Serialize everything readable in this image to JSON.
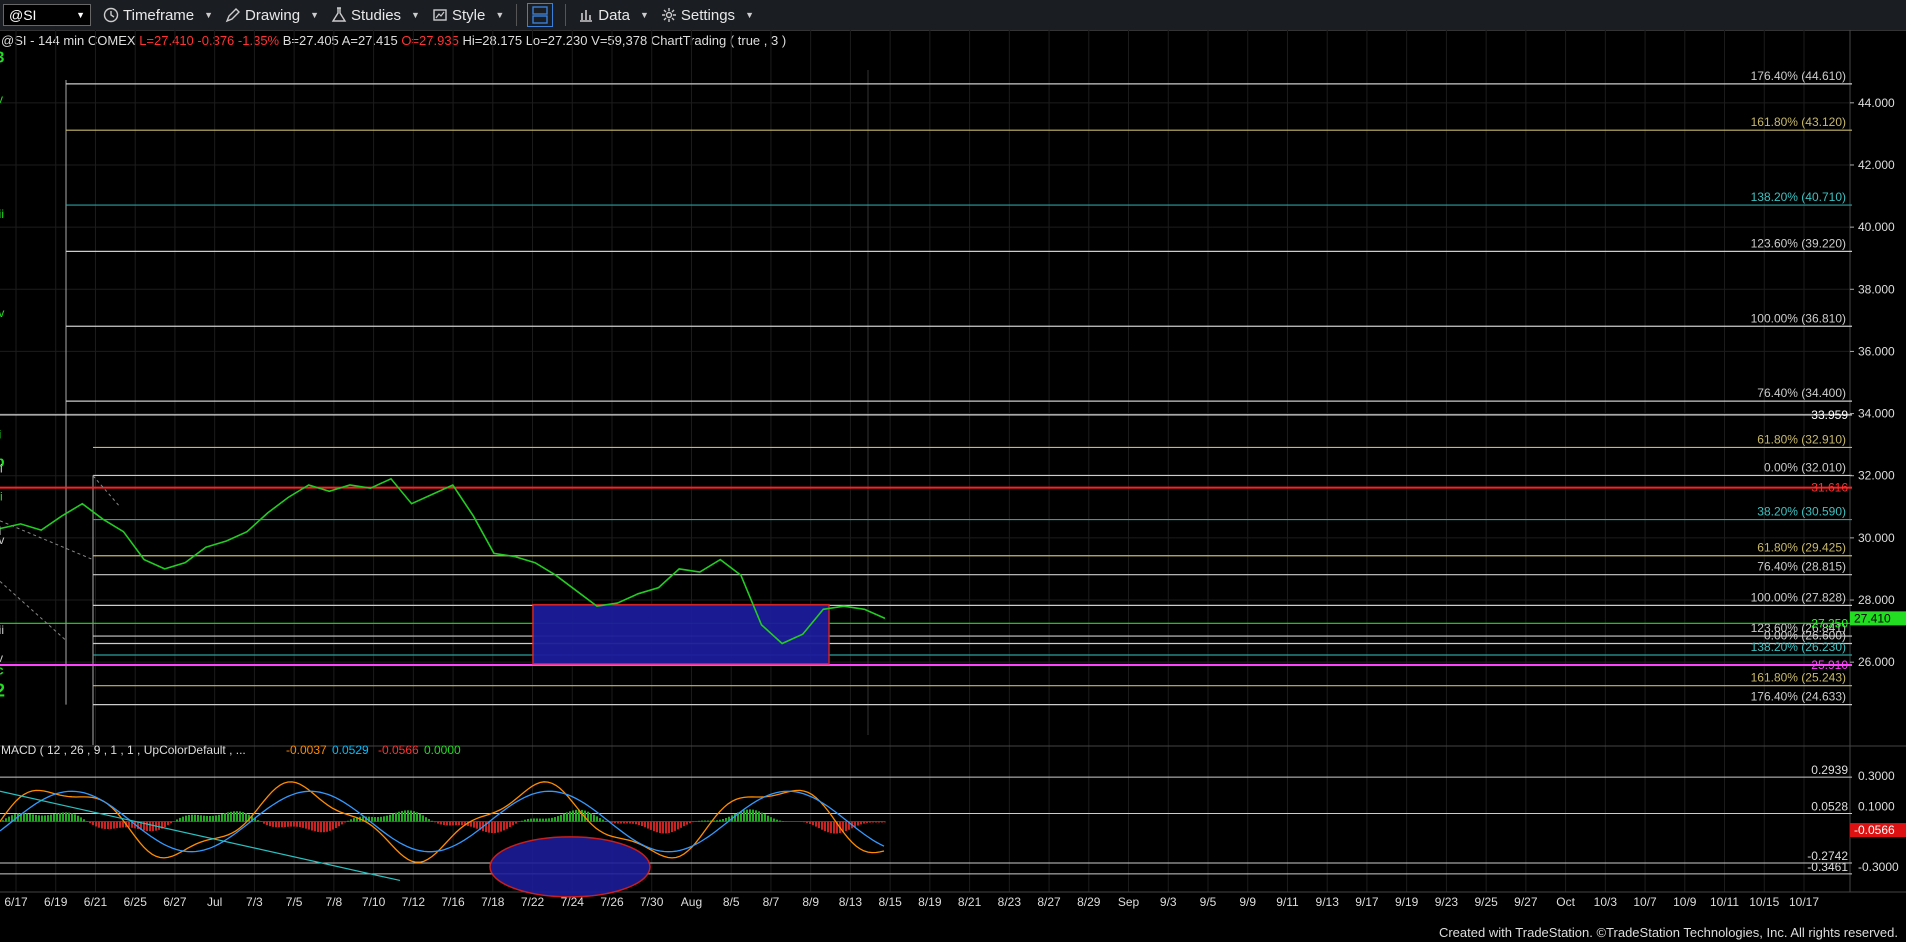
{
  "toolbar": {
    "symbol": "@SI",
    "timeframe": "Timeframe",
    "drawing": "Drawing",
    "studies": "Studies",
    "style": "Style",
    "data": "Data",
    "settings": "Settings"
  },
  "info": {
    "symbol_desc": "@SI - 144 min  COMEX",
    "last": "L=27.410",
    "change": "-0.376",
    "pct": "-1.35%",
    "bid": "B=27.405",
    "ask": "A=27.415",
    "open": "O=27.935",
    "high": "Hi=28.175",
    "low": "Lo=27.230",
    "vol": "V=59,378",
    "study": "ChartTrading ( true , 3 )"
  },
  "footer": "Created with TradeStation. ©TradeStation Technologies, Inc. All rights reserved.",
  "chart_data": {
    "type": "line",
    "price_axis": {
      "ylim": [
        24.3,
        45.7
      ],
      "ticks": [
        "44.000",
        "42.000",
        "40.000",
        "38.000",
        "36.000",
        "34.000",
        "32.000",
        "30.000",
        "28.000",
        "26.000"
      ],
      "tick_values": [
        44,
        42,
        40,
        38,
        36,
        34,
        32,
        30,
        28,
        26
      ]
    },
    "date_ticks": [
      "6/17",
      "6/19",
      "6/21",
      "6/25",
      "6/27",
      "Jul",
      "7/3",
      "7/5",
      "7/8",
      "7/10",
      "7/12",
      "7/16",
      "7/18",
      "7/22",
      "7/24",
      "7/26",
      "7/30",
      "Aug",
      "8/5",
      "8/7",
      "8/9",
      "8/13",
      "8/15",
      "8/19",
      "8/21",
      "8/23",
      "8/27",
      "8/29",
      "Sep",
      "9/3",
      "9/5",
      "9/9",
      "9/11",
      "9/13",
      "9/17",
      "9/19",
      "9/23",
      "9/25",
      "9/27",
      "Oct",
      "10/3",
      "10/7",
      "10/9",
      "10/11",
      "10/15",
      "10/17"
    ],
    "price_series": [
      [
        "6/17",
        30.3
      ],
      [
        "6/18",
        30.45
      ],
      [
        "6/19",
        30.25
      ],
      [
        "6/20",
        30.7
      ],
      [
        "6/21",
        31.1
      ],
      [
        "6/21",
        30.6
      ],
      [
        "6/24",
        30.2
      ],
      [
        "6/25",
        29.3
      ],
      [
        "6/26",
        29.0
      ],
      [
        "6/27",
        29.2
      ],
      [
        "6/28",
        29.7
      ],
      [
        "7/1",
        29.9
      ],
      [
        "7/2",
        30.2
      ],
      [
        "7/3",
        30.8
      ],
      [
        "7/4",
        31.3
      ],
      [
        "7/5",
        31.7
      ],
      [
        "7/8",
        31.5
      ],
      [
        "7/9",
        31.7
      ],
      [
        "7/10",
        31.6
      ],
      [
        "7/11",
        31.9
      ],
      [
        "7/12",
        31.1
      ],
      [
        "7/15",
        31.4
      ],
      [
        "7/16",
        31.7
      ],
      [
        "7/17",
        30.7
      ],
      [
        "7/18",
        29.5
      ],
      [
        "7/19",
        29.4
      ],
      [
        "7/22",
        29.2
      ],
      [
        "7/23",
        28.8
      ],
      [
        "7/24",
        28.3
      ],
      [
        "7/25",
        27.8
      ],
      [
        "7/26",
        27.9
      ],
      [
        "7/29",
        28.2
      ],
      [
        "7/30",
        28.4
      ],
      [
        "7/31",
        29.0
      ],
      [
        "8/1",
        28.9
      ],
      [
        "8/2",
        29.3
      ],
      [
        "8/5",
        28.8
      ],
      [
        "8/6",
        27.2
      ],
      [
        "8/7",
        26.6
      ],
      [
        "8/8",
        26.9
      ],
      [
        "8/9",
        27.7
      ],
      [
        "8/12",
        27.8
      ],
      [
        "8/13",
        27.7
      ],
      [
        "8/14",
        27.41
      ]
    ],
    "fib_levels": [
      {
        "label": "176.40% (44.610)",
        "value": 44.61,
        "color": "#cccccc"
      },
      {
        "label": "161.80% (43.120)",
        "value": 43.12,
        "color": "#c8b86a"
      },
      {
        "label": "138.20% (40.710)",
        "value": 40.71,
        "color": "#2aa0a0"
      },
      {
        "label": "123.60% (39.220)",
        "value": 39.22,
        "color": "#cccccc"
      },
      {
        "label": "100.00% (36.810)",
        "value": 36.81,
        "color": "#cccccc"
      },
      {
        "label": "76.40% (34.400)",
        "value": 34.4,
        "color": "#cccccc"
      },
      {
        "label": "61.80% (32.910)",
        "value": 32.91,
        "color": "#c8b86a"
      },
      {
        "label": "0.00% (32.010)",
        "value": 32.01,
        "color": "#cccccc"
      },
      {
        "label": "38.20% (30.590)",
        "value": 30.59,
        "color": "#2aa0a0"
      },
      {
        "label": "61.80% (29.425)",
        "value": 29.425,
        "color": "#c8b86a"
      },
      {
        "label": "76.40% (28.815)",
        "value": 28.815,
        "color": "#cccccc"
      },
      {
        "label": "100.00% (27.828)",
        "value": 27.828,
        "color": "#cccccc"
      },
      {
        "label": "123.60% (26.841)",
        "value": 26.841,
        "color": "#cccccc"
      },
      {
        "label": "0.00% (26.600)",
        "value": 26.6,
        "color": "#cccccc"
      },
      {
        "label": "138.20% (26.230)",
        "value": 26.23,
        "color": "#2aa0a0"
      },
      {
        "label": "161.80% (25.243)",
        "value": 25.243,
        "color": "#c8b86a"
      },
      {
        "label": "176.40% (24.633)",
        "value": 24.633,
        "color": "#cccccc"
      }
    ],
    "price_tags": [
      {
        "label": "33.959",
        "value": 33.959,
        "color": "#ffffff",
        "bg": ""
      },
      {
        "label": "31.616",
        "value": 31.616,
        "color": "#ff3030",
        "bg": ""
      },
      {
        "label": "27.250",
        "value": 27.25,
        "color": "#22ff22",
        "bg": ""
      },
      {
        "label": "27.410",
        "value": 27.41,
        "color": "#000000",
        "bg": "#22dd22"
      },
      {
        "label": "25.910",
        "value": 25.91,
        "color": "#ff44ff",
        "bg": ""
      }
    ],
    "wave_labels": [
      {
        "text": "3",
        "date": "10/13",
        "value": 45.3,
        "color": "#22dd22",
        "size": 16,
        "bold": true
      },
      {
        "text": "v",
        "date": "10/13",
        "value": 44.0,
        "color": "#22dd22",
        "size": 12,
        "bold": false
      },
      {
        "text": "iii",
        "date": "9/20",
        "value": 40.3,
        "color": "#22dd22",
        "size": 12,
        "bold": false
      },
      {
        "text": "iv",
        "date": "10/2",
        "value": 37.1,
        "color": "#22dd22",
        "size": 12,
        "bold": false
      },
      {
        "text": "i",
        "date": "8/30",
        "value": 33.2,
        "color": "#22dd22",
        "size": 12,
        "bold": false
      },
      {
        "text": "ii",
        "date": "9/6",
        "value": 31.2,
        "color": "#22dd22",
        "size": 12,
        "bold": false
      },
      {
        "text": "b",
        "date": "7/11",
        "value": 32.3,
        "color": "#22dd22",
        "size": 15,
        "bold": true
      },
      {
        "text": "ii",
        "date": "7/17",
        "value": 32.1,
        "color": "#cccccc",
        "size": 12,
        "bold": false
      },
      {
        "text": "i",
        "date": "7/14",
        "value": 30.1,
        "color": "#cccccc",
        "size": 12,
        "bold": false
      },
      {
        "text": "iv",
        "date": "8/3",
        "value": 29.8,
        "color": "#cccccc",
        "size": 12,
        "bold": false
      },
      {
        "text": "iii",
        "date": "7/27",
        "value": 26.9,
        "color": "#cccccc",
        "size": 12,
        "bold": false
      },
      {
        "text": "v",
        "date": "8/8",
        "value": 26.0,
        "color": "#cccccc",
        "size": 12,
        "bold": false
      },
      {
        "text": "c",
        "date": "8/8",
        "value": 25.6,
        "color": "#22dd22",
        "size": 13,
        "bold": true
      },
      {
        "text": "2",
        "date": "8/8",
        "value": 24.9,
        "color": "#22dd22",
        "size": 18,
        "bold": true
      }
    ],
    "macd": {
      "label": "MACD ( 12 , 26 , 9 , 1 , 1 , UpColorDefault , ...",
      "values": [
        "-0.0037",
        "0.0529",
        "-0.0566",
        "0.0000"
      ],
      "value_colors": [
        "#ff8c00",
        "#00bfff",
        "#ff3333",
        "#22dd22"
      ],
      "ylim": [
        -0.42,
        0.42
      ],
      "axis_ticks": [
        "0.3000",
        "0.1000",
        "-0.3000"
      ],
      "axis_tick_values": [
        0.3,
        0.1,
        -0.3
      ],
      "level_labels": [
        "0.2939",
        "0.0528",
        "-0.2742",
        "-0.3461"
      ],
      "level_values": [
        0.2939,
        0.0528,
        -0.2742,
        -0.3461
      ],
      "current_tag": "-0.0566"
    }
  }
}
